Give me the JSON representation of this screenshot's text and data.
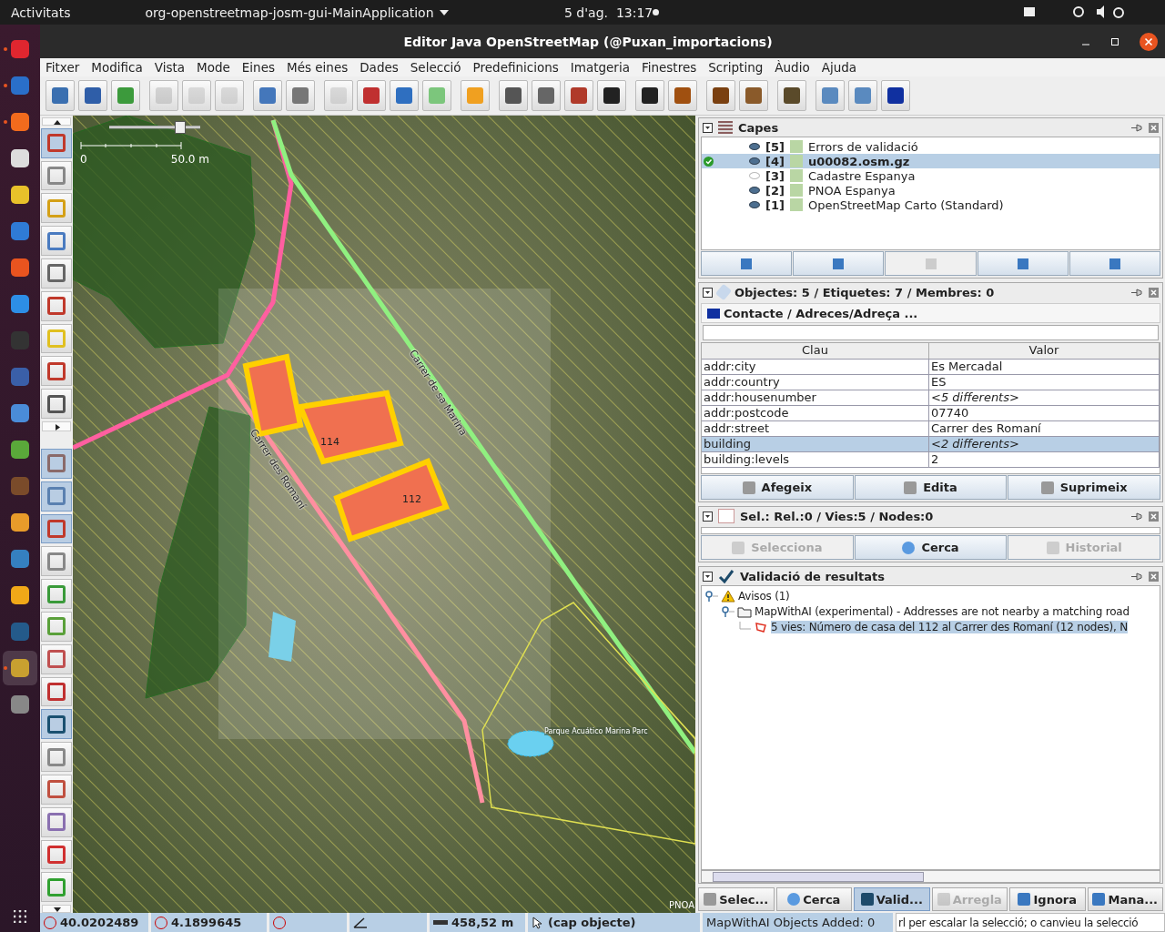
{
  "topbar": {
    "activities": "Activitats",
    "app_menu": "org-openstreetmap-josm-gui-MainApplication",
    "clock": "5 d'ag.  13:17"
  },
  "dock": [
    {
      "running": true,
      "selected": false
    },
    {
      "running": true,
      "selected": false
    },
    {
      "running": true,
      "selected": false
    },
    {
      "running": false,
      "selected": false
    },
    {
      "running": false,
      "selected": false
    },
    {
      "running": false,
      "selected": false
    },
    {
      "running": false,
      "selected": false
    },
    {
      "running": false,
      "selected": false
    },
    {
      "running": false,
      "selected": false
    },
    {
      "running": false,
      "selected": false
    },
    {
      "running": false,
      "selected": false
    },
    {
      "running": false,
      "selected": false
    },
    {
      "running": false,
      "selected": false
    },
    {
      "running": false,
      "selected": false
    },
    {
      "running": false,
      "selected": false
    },
    {
      "running": false,
      "selected": false
    },
    {
      "running": false,
      "selected": false
    },
    {
      "running": true,
      "selected": true
    },
    {
      "running": false,
      "selected": false
    }
  ],
  "window": {
    "title": "Editor Java OpenStreetMap (@Puxan_importacions)"
  },
  "menu": [
    "Fitxer",
    "Modifica",
    "Vista",
    "Mode",
    "Eines",
    "Més eines",
    "Dades",
    "Selecció",
    "Predefinicions",
    "Imatgeria",
    "Finestres",
    "Scripting",
    "Àudio",
    "Ajuda"
  ],
  "toolbar": [
    {
      "disabled": false
    },
    {
      "disabled": false
    },
    {
      "disabled": false
    },
    {
      "disabled": true
    },
    {
      "disabled": true
    },
    {
      "disabled": true
    },
    {
      "disabled": false
    },
    {
      "disabled": false
    },
    {
      "disabled": true
    },
    {
      "disabled": false
    },
    {
      "disabled": false
    },
    {
      "disabled": false
    },
    {
      "disabled": false
    },
    {
      "disabled": false
    },
    {
      "disabled": false
    },
    {
      "disabled": false
    },
    {
      "disabled": false
    },
    {
      "disabled": false
    },
    {
      "disabled": false
    },
    {
      "disabled": false
    },
    {
      "disabled": false
    },
    {
      "disabled": false
    },
    {
      "disabled": false
    },
    {
      "disabled": false
    },
    {
      "disabled": false
    }
  ],
  "tools": [
    {
      "selected": true
    },
    {
      "selected": false
    },
    {
      "selected": false
    },
    {
      "selected": false
    },
    {
      "selected": false
    },
    {
      "selected": false
    },
    {
      "selected": false
    },
    {
      "selected": false
    },
    {
      "selected": false
    },
    {
      "selected": true
    },
    {
      "selected": true
    },
    {
      "selected": true
    },
    {
      "selected": false
    },
    {
      "selected": false
    },
    {
      "selected": false
    },
    {
      "selected": false
    },
    {
      "selected": false
    },
    {
      "selected": true
    },
    {
      "selected": false
    },
    {
      "selected": false
    },
    {
      "selected": false
    },
    {
      "selected": false
    },
    {
      "selected": false
    }
  ],
  "map": {
    "scale_start": "0",
    "scale_end": "50.0 m",
    "zoom": {
      "level": 0.78
    },
    "labels": [
      {
        "kind": "street",
        "text": "Carrer de sa Marina"
      },
      {
        "kind": "street",
        "text": "Carrer des Romaní"
      },
      {
        "kind": "number",
        "text": "114"
      },
      {
        "kind": "number",
        "text": "112"
      },
      {
        "kind": "poi",
        "text": "Parque Acuático Marina Parc"
      },
      {
        "kind": "attribution",
        "text": "PNOA"
      }
    ]
  },
  "layers_panel": {
    "title": "Capes",
    "layers": [
      {
        "index": "[5]",
        "name": "Errors de validació",
        "visible": true,
        "selected": false,
        "active": false
      },
      {
        "index": "[4]",
        "name": "u00082.osm.gz",
        "visible": true,
        "selected": true,
        "active": true
      },
      {
        "index": "[3]",
        "name": "Cadastre Espanya",
        "visible": false,
        "selected": false,
        "active": false
      },
      {
        "index": "[2]",
        "name": "PNOA Espanya",
        "visible": true,
        "selected": false,
        "active": false
      },
      {
        "index": "[1]",
        "name": "OpenStreetMap Carto (Standard)",
        "visible": true,
        "selected": false,
        "active": false
      }
    ],
    "buttons": [
      {
        "disabled": false
      },
      {
        "disabled": false
      },
      {
        "disabled": true
      },
      {
        "disabled": false
      },
      {
        "disabled": false
      }
    ]
  },
  "tags_panel": {
    "title": "Objectes: 5 / Etiquetes: 7 / Membres: 0",
    "preset": "Contacte / Adreces/Adreça ...",
    "columns": [
      "Clau",
      "Valor"
    ],
    "rows": [
      {
        "key": "addr:city",
        "value": "Es Mercadal",
        "kind": "single",
        "selected": false
      },
      {
        "key": "addr:country",
        "value": "ES",
        "kind": "single",
        "selected": false
      },
      {
        "key": "addr:housenumber",
        "value": "<5 differents>",
        "kind": "mixed",
        "selected": false
      },
      {
        "key": "addr:postcode",
        "value": "07740",
        "kind": "single",
        "selected": false
      },
      {
        "key": "addr:street",
        "value": "Carrer des Romaní",
        "kind": "single",
        "selected": false
      },
      {
        "key": "building",
        "value": "<2 differents>",
        "kind": "mixed",
        "selected": true
      },
      {
        "key": "building:levels",
        "value": "2",
        "kind": "single",
        "selected": false
      }
    ],
    "buttons": [
      "Afegeix",
      "Edita",
      "Suprimeix"
    ]
  },
  "selection_panel": {
    "title": "Sel.: Rel.:0 / Vies:5 / Nodes:0",
    "buttons": [
      {
        "label": "Selecciona",
        "disabled": true
      },
      {
        "label": "Cerca",
        "disabled": false
      },
      {
        "label": "Historial",
        "disabled": true
      }
    ]
  },
  "validation_panel": {
    "title": "Validació de resultats",
    "tree": [
      {
        "label": "Avisos (1)",
        "kind": "warning",
        "expanded": true,
        "selected": false,
        "children": [
          {
            "label": "MapWithAI (experimental) - Addresses are not nearby a matching road",
            "kind": "folder",
            "expanded": true,
            "selected": false,
            "children": [
              {
                "label": "5 vies: Número de casa del 112 al Carrer des Romaní (12 nodes), N",
                "kind": "way",
                "selected": true
              }
            ]
          }
        ]
      }
    ]
  },
  "panel_tabs": [
    {
      "label": "Selec...",
      "selected": false,
      "disabled": false
    },
    {
      "label": "Cerca",
      "selected": false,
      "disabled": false
    },
    {
      "label": "Valid...",
      "selected": true,
      "disabled": false
    },
    {
      "label": "Arregla",
      "selected": false,
      "disabled": true
    },
    {
      "label": "Ignora",
      "selected": false,
      "disabled": false
    },
    {
      "label": "Mana...",
      "selected": false,
      "disabled": false
    }
  ],
  "status_bar": {
    "latitude": "40.0202489",
    "longitude": "4.1899645",
    "distance": "458,52 m",
    "object": "(cap objecte)",
    "plugin": "MapWithAI Objects Added: 0",
    "help": "rl per escalar la selecció; o canvieu la selecció"
  }
}
